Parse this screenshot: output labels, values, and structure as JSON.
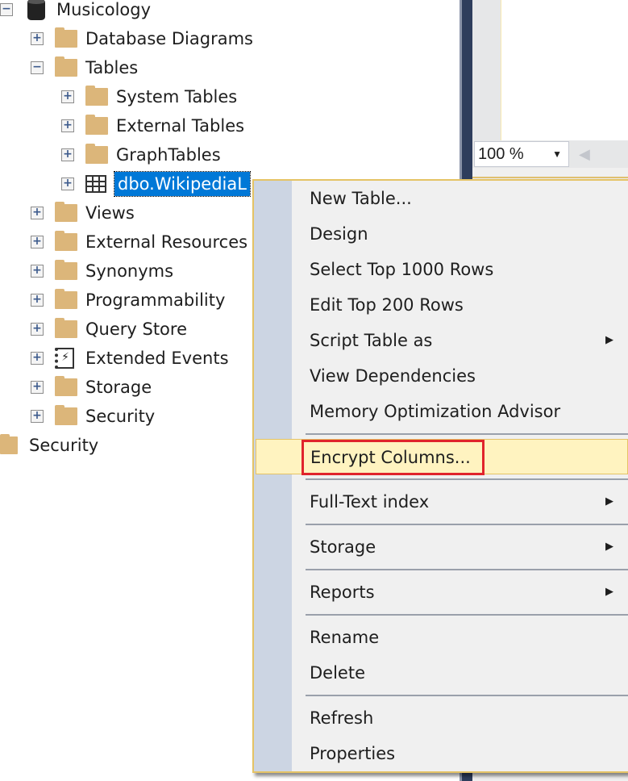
{
  "tree": {
    "root": {
      "label": "Musicology",
      "icon": "database-icon",
      "expanded": true
    },
    "items": [
      {
        "label": "Database Diagrams",
        "icon": "folder-icon",
        "expanded": false
      },
      {
        "label": "Tables",
        "icon": "folder-icon",
        "expanded": true
      },
      {
        "label": "System Tables",
        "icon": "folder-icon",
        "expanded": false
      },
      {
        "label": "External Tables",
        "icon": "folder-icon",
        "expanded": false
      },
      {
        "label": "GraphTables",
        "icon": "folder-icon",
        "expanded": false
      },
      {
        "label": "dbo.WikipediaL",
        "icon": "table-icon",
        "expanded": false,
        "selected": true
      },
      {
        "label": "Views",
        "icon": "folder-icon",
        "expanded": false
      },
      {
        "label": "External Resources",
        "icon": "folder-icon",
        "expanded": false
      },
      {
        "label": "Synonyms",
        "icon": "folder-icon",
        "expanded": false
      },
      {
        "label": "Programmability",
        "icon": "folder-icon",
        "expanded": false
      },
      {
        "label": "Query Store",
        "icon": "folder-icon",
        "expanded": false
      },
      {
        "label": "Extended Events",
        "icon": "extended-events-icon",
        "expanded": false
      },
      {
        "label": "Storage",
        "icon": "folder-icon",
        "expanded": false
      },
      {
        "label": "Security",
        "icon": "folder-icon",
        "expanded": false
      }
    ],
    "server_security": {
      "label": "Security",
      "icon": "folder-icon"
    }
  },
  "editor": {
    "zoom": "100 %"
  },
  "context_menu": {
    "items": [
      {
        "label": "New Table..."
      },
      {
        "label": "Design"
      },
      {
        "label": "Select Top 1000 Rows"
      },
      {
        "label": "Edit Top 200 Rows"
      },
      {
        "label": "Script Table as",
        "submenu": true
      },
      {
        "label": "View Dependencies"
      },
      {
        "label": "Memory Optimization Advisor"
      },
      {
        "label": "Encrypt Columns...",
        "highlighted": true
      },
      {
        "label": "Full-Text index",
        "submenu": true
      },
      {
        "label": "Storage",
        "submenu": true
      },
      {
        "label": "Reports",
        "submenu": true
      },
      {
        "label": "Rename"
      },
      {
        "label": "Delete"
      },
      {
        "label": "Refresh"
      },
      {
        "label": "Properties"
      }
    ]
  },
  "colors": {
    "selection": "#0078d7",
    "highlight": "#fff3c0",
    "highlight_box": "#e0242c",
    "menu_border": "#e5c365"
  }
}
